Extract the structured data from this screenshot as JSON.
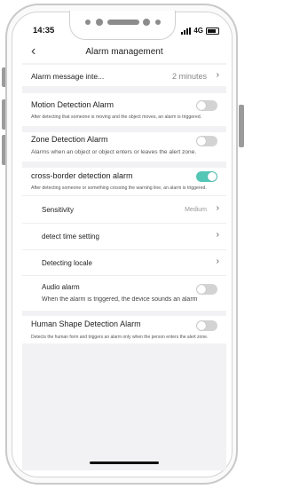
{
  "status_bar": {
    "time": "14:35",
    "network": "4G"
  },
  "nav": {
    "title": "Alarm management"
  },
  "alarm_interval": {
    "label": "Alarm message inte...",
    "value": "2 minutes"
  },
  "motion": {
    "title": "Motion Detection Alarm",
    "desc": "After detecting that someone is moving and the object moves, an alarm is triggered.",
    "enabled": false
  },
  "zone": {
    "title": "Zone Detection Alarm",
    "desc": "Alarms when an object or object enters or leaves the alert zone.",
    "enabled": false
  },
  "cross_border": {
    "title": "cross-border detection alarm",
    "desc": "After detecting someone or something crossing the warning line, an alarm is triggered.",
    "enabled": true,
    "sensitivity": {
      "label": "Sensitivity",
      "value": "Medium"
    },
    "detect_time": {
      "label": "detect time setting"
    },
    "detect_locale": {
      "label": "Detecting locale"
    },
    "audio": {
      "label": "Audio alarm",
      "desc": "When the alarm is triggered, the device sounds an alarm",
      "enabled": false
    }
  },
  "human_shape": {
    "title": "Human Shape Detection Alarm",
    "desc": "Detects the human form and triggers an alarm only when the person enters the alert zone.",
    "enabled": false
  },
  "colors": {
    "toggle_on": "#54c6b6",
    "toggle_off": "#d3d3d3",
    "section_bg": "#f2f2f4"
  }
}
